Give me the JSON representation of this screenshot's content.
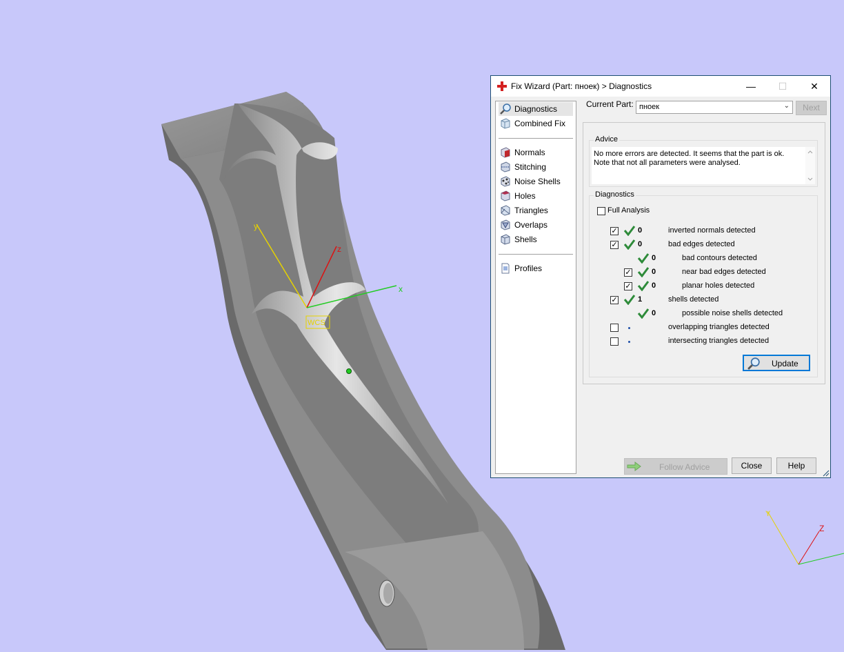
{
  "window": {
    "title": "Fix Wizard (Part: пноек) > Diagnostics",
    "minimize": "—",
    "maximize": "☐",
    "close": "✕"
  },
  "nav": {
    "top": [
      {
        "label": "Diagnostics",
        "icon": "magnifier-icon",
        "selected": true
      },
      {
        "label": "Combined Fix",
        "icon": "cube-icon"
      }
    ],
    "fixes": [
      {
        "label": "Normals",
        "icon": "normals-cube-icon"
      },
      {
        "label": "Stitching",
        "icon": "stitching-cube-icon"
      },
      {
        "label": "Noise Shells",
        "icon": "noise-shells-icon"
      },
      {
        "label": "Holes",
        "icon": "holes-cube-icon"
      },
      {
        "label": "Triangles",
        "icon": "triangles-cube-icon"
      },
      {
        "label": "Overlaps",
        "icon": "overlaps-cube-icon"
      },
      {
        "label": "Shells",
        "icon": "shells-cube-icon"
      }
    ],
    "profiles": {
      "label": "Profiles",
      "icon": "document-icon"
    }
  },
  "current_part": {
    "label": "Current Part:",
    "value": "пноек",
    "next_label": "Next"
  },
  "advice": {
    "title": "Advice",
    "line1": "No more errors are detected. It seems that the part is ok.",
    "line2": "Note that not all parameters were analysed."
  },
  "diagnostics": {
    "title": "Diagnostics",
    "full_analysis_label": "Full Analysis",
    "rows": [
      {
        "checkbox": true,
        "checked": true,
        "status": "ok",
        "count": "0",
        "text": "inverted normals detected",
        "indent": false
      },
      {
        "checkbox": true,
        "checked": true,
        "status": "ok",
        "count": "0",
        "text": "bad edges detected",
        "indent": false
      },
      {
        "checkbox": false,
        "checked": false,
        "status": "ok",
        "count": "0",
        "text": "bad contours detected",
        "indent": true
      },
      {
        "checkbox": true,
        "checked": true,
        "status": "ok",
        "count": "0",
        "text": "near bad edges detected",
        "indent": true
      },
      {
        "checkbox": true,
        "checked": true,
        "status": "ok",
        "count": "0",
        "text": "planar holes detected",
        "indent": true
      },
      {
        "checkbox": true,
        "checked": true,
        "status": "ok",
        "count": "1",
        "text": "shells detected",
        "indent": false
      },
      {
        "checkbox": false,
        "checked": false,
        "status": "ok",
        "count": "0",
        "text": "possible noise shells detected",
        "indent": true
      },
      {
        "checkbox": true,
        "checked": false,
        "status": "pending",
        "count": "",
        "text": "overlapping triangles detected",
        "indent": false
      },
      {
        "checkbox": true,
        "checked": false,
        "status": "pending",
        "count": "",
        "text": "intersecting triangles detected",
        "indent": false
      }
    ],
    "update_label": "Update"
  },
  "footer": {
    "follow_advice_label": "Follow Advice",
    "close_label": "Close",
    "help_label": "Help"
  },
  "viewport": {
    "wcs_label": "WCS",
    "axis_x": "x",
    "axis_y": "y",
    "axis_z": "z",
    "mini_axis_y": "Y",
    "mini_axis_z": "Z"
  },
  "colors": {
    "background": "#c8c8fa",
    "axis_x": "#22cc22",
    "axis_y": "#e6d200",
    "axis_z": "#dd1111",
    "check_green": "#2e8b3a",
    "title_border": "#1c4d73"
  }
}
